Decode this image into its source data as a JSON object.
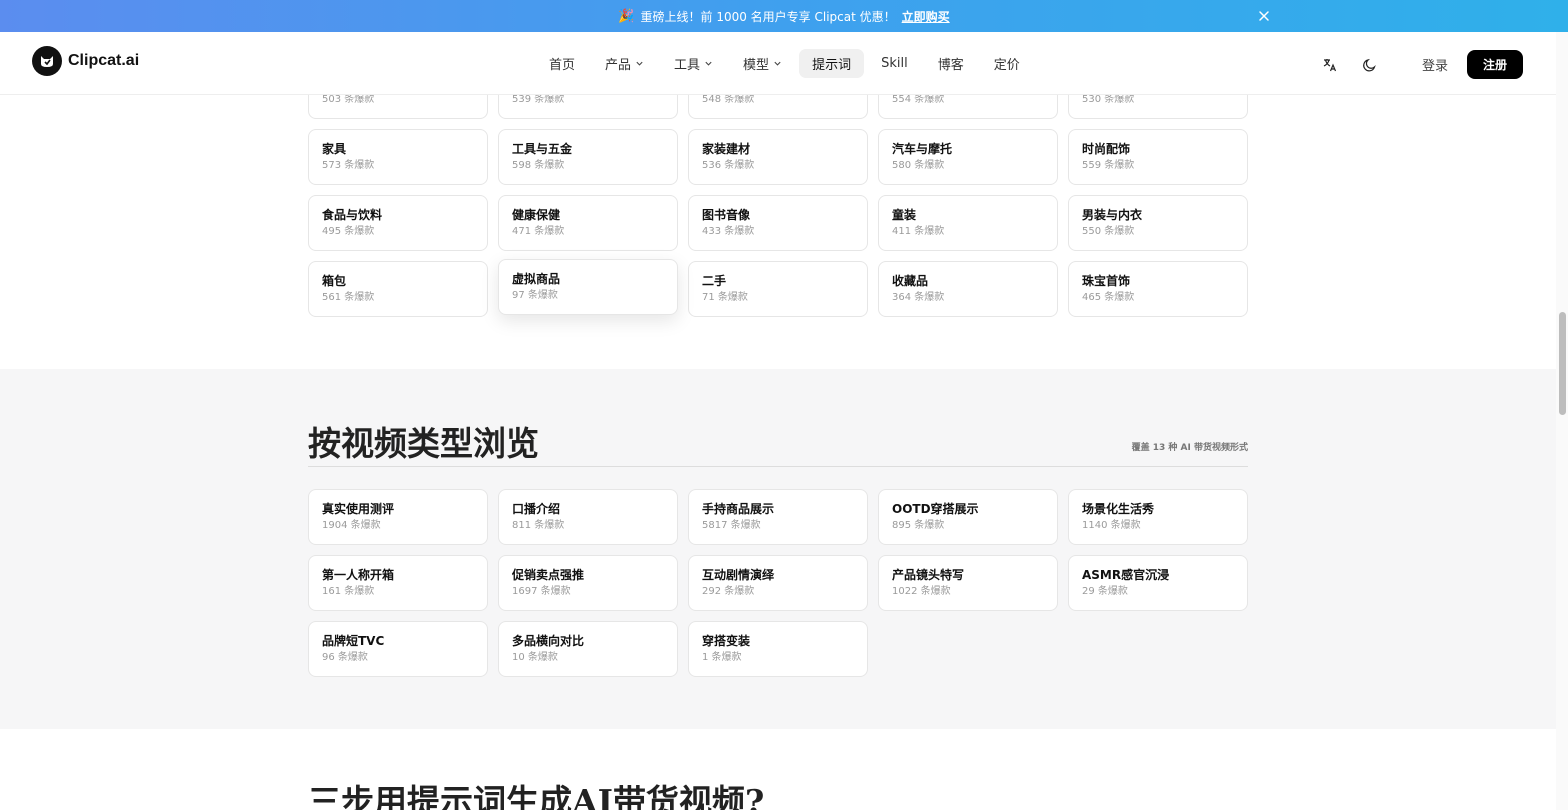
{
  "banner": {
    "text": "重磅上线！前 1000 名用户专享 Clipcat 优惠！",
    "link": "立即购买"
  },
  "header": {
    "logo": "Clipcat.ai",
    "nav": [
      "首页",
      "产品",
      "工具",
      "模型",
      "提示词",
      "Skill",
      "博客",
      "定价"
    ],
    "login": "登录",
    "signup": "注册"
  },
  "categories_partial": [
    {
      "count": "503 条爆款"
    },
    {
      "count": "539 条爆款"
    },
    {
      "count": "548 条爆款"
    },
    {
      "count": "554 条爆款"
    },
    {
      "count": "530 条爆款"
    }
  ],
  "categories": [
    {
      "name": "家具",
      "count": "573 条爆款"
    },
    {
      "name": "工具与五金",
      "count": "598 条爆款"
    },
    {
      "name": "家装建材",
      "count": "536 条爆款"
    },
    {
      "name": "汽车与摩托",
      "count": "580 条爆款"
    },
    {
      "name": "时尚配饰",
      "count": "559 条爆款"
    },
    {
      "name": "食品与饮料",
      "count": "495 条爆款"
    },
    {
      "name": "健康保健",
      "count": "471 条爆款"
    },
    {
      "name": "图书音像",
      "count": "433 条爆款"
    },
    {
      "name": "童装",
      "count": "411 条爆款"
    },
    {
      "name": "男装与内衣",
      "count": "550 条爆款"
    },
    {
      "name": "箱包",
      "count": "561 条爆款"
    },
    {
      "name": "虚拟商品",
      "count": "97 条爆款"
    },
    {
      "name": "二手",
      "count": "71 条爆款"
    },
    {
      "name": "收藏品",
      "count": "364 条爆款"
    },
    {
      "name": "珠宝首饰",
      "count": "465 条爆款"
    }
  ],
  "video_section": {
    "title": "按视频类型浏览",
    "subtitle": "覆盖 13 种 AI 带货视频形式",
    "items": [
      {
        "name": "真实使用测评",
        "count": "1904 条爆款"
      },
      {
        "name": "口播介绍",
        "count": "811 条爆款"
      },
      {
        "name": "手持商品展示",
        "count": "5817 条爆款"
      },
      {
        "name": "OOTD穿搭展示",
        "count": "895 条爆款"
      },
      {
        "name": "场景化生活秀",
        "count": "1140 条爆款"
      },
      {
        "name": "第一人称开箱",
        "count": "161 条爆款"
      },
      {
        "name": "促销卖点强推",
        "count": "1697 条爆款"
      },
      {
        "name": "互动剧情演绎",
        "count": "292 条爆款"
      },
      {
        "name": "产品镜头特写",
        "count": "1022 条爆款"
      },
      {
        "name": "ASMR感官沉浸",
        "count": "29 条爆款"
      },
      {
        "name": "品牌短TVC",
        "count": "96 条爆款"
      },
      {
        "name": "多品横向对比",
        "count": "10 条爆款"
      },
      {
        "name": "穿搭变装",
        "count": "1 条爆款"
      }
    ]
  },
  "bottom_title": "三步用提示词生成AI带货视频?"
}
